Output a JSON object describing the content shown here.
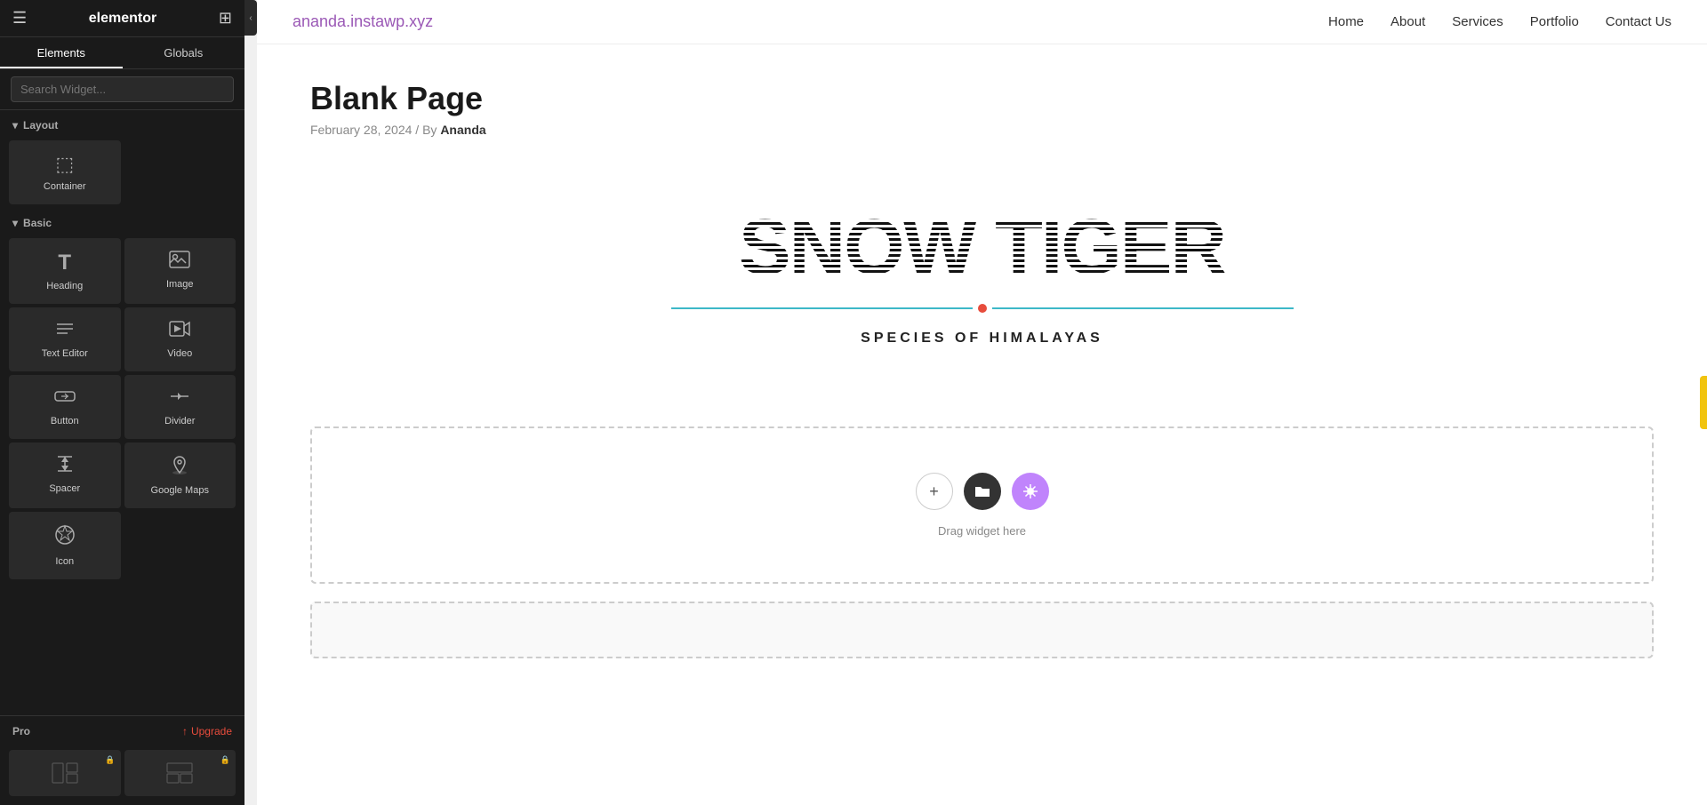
{
  "app": {
    "name": "elementor"
  },
  "panel": {
    "hamburger": "☰",
    "logo": "elementor",
    "grid": "⊞",
    "tabs": [
      {
        "id": "elements",
        "label": "Elements",
        "active": true
      },
      {
        "id": "globals",
        "label": "Globals",
        "active": false
      }
    ],
    "search": {
      "placeholder": "Search Widget..."
    },
    "sections": {
      "layout": {
        "label": "Layout",
        "widgets": [
          {
            "id": "container",
            "label": "Container",
            "icon": "⬚"
          }
        ]
      },
      "basic": {
        "label": "Basic",
        "widgets": [
          {
            "id": "heading",
            "label": "Heading",
            "icon": "T"
          },
          {
            "id": "image",
            "label": "Image",
            "icon": "🖼"
          },
          {
            "id": "text-editor",
            "label": "Text Editor",
            "icon": "≡"
          },
          {
            "id": "video",
            "label": "Video",
            "icon": "▷"
          },
          {
            "id": "button",
            "label": "Button",
            "icon": "⬡"
          },
          {
            "id": "divider",
            "label": "Divider",
            "icon": "⊟"
          },
          {
            "id": "spacer",
            "label": "Spacer",
            "icon": "⇕"
          },
          {
            "id": "google-maps",
            "label": "Google Maps",
            "icon": "📍"
          },
          {
            "id": "icon",
            "label": "Icon",
            "icon": "✦"
          }
        ]
      },
      "pro": {
        "label": "Pro",
        "upgrade_label": "Upgrade",
        "widgets": [
          {
            "id": "pro-widget-1",
            "label": "",
            "icon": "⊞"
          },
          {
            "id": "pro-widget-2",
            "label": "",
            "icon": "⊟"
          }
        ]
      }
    }
  },
  "nav": {
    "logo": "ananda.instawp.xyz",
    "links": [
      {
        "label": "Home",
        "href": "#"
      },
      {
        "label": "About",
        "href": "#"
      },
      {
        "label": "Services",
        "href": "#"
      },
      {
        "label": "Portfolio",
        "href": "#"
      },
      {
        "label": "Contact Us",
        "href": "#"
      }
    ]
  },
  "page": {
    "title": "Blank Page",
    "meta_date": "February 28, 2024",
    "meta_sep": "/",
    "meta_by": "By",
    "meta_author": "Ananda"
  },
  "hero": {
    "title": "SNOW TIGER",
    "subtitle": "SPECIES OF HIMALAYAS"
  },
  "dropzone": {
    "hint": "Drag widget here"
  }
}
